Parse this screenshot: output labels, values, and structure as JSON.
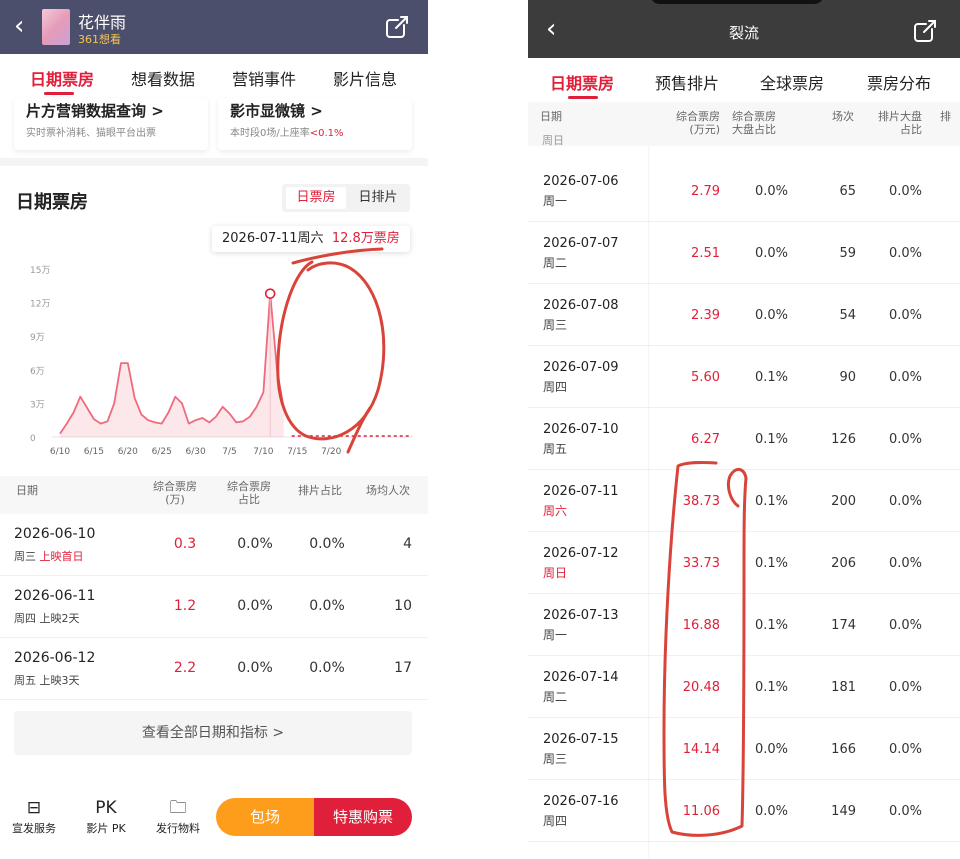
{
  "left": {
    "header": {
      "title": "花伴雨",
      "subtitle": "361想看"
    },
    "tabs": [
      "日期票房",
      "想看数据",
      "营销事件",
      "影片信息"
    ],
    "cards": [
      {
        "title": "片方营销数据查询 >",
        "sub": "实时票补消耗、猫眼平台出票"
      },
      {
        "title": "影市显微镜 >",
        "sub_prefix": "本时段0场/上座率",
        "sub_red": "<0.1%"
      }
    ],
    "section_title": "日期票房",
    "toggle": [
      "日票房",
      "日排片"
    ],
    "tooltip": {
      "date": "2026-07-11周六",
      "value": "12.8万票房"
    },
    "table_headers": [
      "日期",
      "综合票房\n(万)",
      "综合票房\n占比",
      "排片占比",
      "场均人次"
    ],
    "rows": [
      {
        "date": "2026-06-10",
        "weekday": "周三",
        "note": "上映首日",
        "note_red": true,
        "boxoffice": "0.3",
        "share": "0.0%",
        "schedule": "0.0%",
        "avg": "4"
      },
      {
        "date": "2026-06-11",
        "weekday": "周四",
        "note": "上映2天",
        "note_red": false,
        "boxoffice": "1.2",
        "share": "0.0%",
        "schedule": "0.0%",
        "avg": "10"
      },
      {
        "date": "2026-06-12",
        "weekday": "周五",
        "note": "上映3天",
        "note_red": false,
        "boxoffice": "2.2",
        "share": "0.0%",
        "schedule": "0.0%",
        "avg": "17"
      }
    ],
    "view_all": "查看全部日期和指标 >",
    "bottom_nav": [
      {
        "label": "宣发服务",
        "icon": "⊟"
      },
      {
        "label": "影片 PK",
        "icon": "PK"
      },
      {
        "label": "发行物料",
        "icon": "🗀"
      }
    ],
    "btn_baochang": "包场",
    "btn_buy": "特惠购票"
  },
  "right": {
    "header": {
      "title": "裂流"
    },
    "tabs": [
      "日期票房",
      "预售排片",
      "全球票房",
      "票房分布"
    ],
    "table_headers": [
      "日期",
      "综合票房\n(万元)",
      "综合票房\n大盘占比",
      "场次",
      "排片大盘\n占比",
      "排"
    ],
    "partial_row": "周日",
    "rows": [
      {
        "date": "2026-07-06",
        "weekday": "周一",
        "weekend": false,
        "boxoffice": "2.79",
        "share": "0.0%",
        "shows": "65",
        "schedule": "0.0%"
      },
      {
        "date": "2026-07-07",
        "weekday": "周二",
        "weekend": false,
        "boxoffice": "2.51",
        "share": "0.0%",
        "shows": "59",
        "schedule": "0.0%"
      },
      {
        "date": "2026-07-08",
        "weekday": "周三",
        "weekend": false,
        "boxoffice": "2.39",
        "share": "0.0%",
        "shows": "54",
        "schedule": "0.0%"
      },
      {
        "date": "2026-07-09",
        "weekday": "周四",
        "weekend": false,
        "boxoffice": "5.60",
        "share": "0.1%",
        "shows": "90",
        "schedule": "0.0%"
      },
      {
        "date": "2026-07-10",
        "weekday": "周五",
        "weekend": false,
        "boxoffice": "6.27",
        "share": "0.1%",
        "shows": "126",
        "schedule": "0.0%"
      },
      {
        "date": "2026-07-11",
        "weekday": "周六",
        "weekend": true,
        "boxoffice": "38.73",
        "share": "0.1%",
        "shows": "200",
        "schedule": "0.0%"
      },
      {
        "date": "2026-07-12",
        "weekday": "周日",
        "weekend": true,
        "boxoffice": "33.73",
        "share": "0.1%",
        "shows": "206",
        "schedule": "0.0%"
      },
      {
        "date": "2026-07-13",
        "weekday": "周一",
        "weekend": false,
        "boxoffice": "16.88",
        "share": "0.1%",
        "shows": "174",
        "schedule": "0.0%"
      },
      {
        "date": "2026-07-14",
        "weekday": "周二",
        "weekend": false,
        "boxoffice": "20.48",
        "share": "0.1%",
        "shows": "181",
        "schedule": "0.0%"
      },
      {
        "date": "2026-07-15",
        "weekday": "周三",
        "weekend": false,
        "boxoffice": "14.14",
        "share": "0.0%",
        "shows": "166",
        "schedule": "0.0%"
      },
      {
        "date": "2026-07-16",
        "weekday": "周四",
        "weekend": false,
        "boxoffice": "11.06",
        "share": "0.0%",
        "shows": "149",
        "schedule": "0.0%"
      }
    ]
  },
  "colors": {
    "accent": "#e0203a",
    "orange": "#fd9d1b",
    "left_header": "#4c4f6b",
    "right_header": "#3c3c3c",
    "annotation": "#d9443a"
  },
  "chart_data": {
    "type": "area",
    "x_ticks": [
      "6/10",
      "6/15",
      "6/20",
      "6/25",
      "6/30",
      "7/5",
      "7/10",
      "7/15",
      "7/20"
    ],
    "y_ticks": [
      "0",
      "3万",
      "6万",
      "9万",
      "12万",
      "15万"
    ],
    "ylim": [
      0,
      15
    ],
    "x_start_label": "6/10",
    "series": [
      {
        "unit": "万",
        "x": [
          "6/10",
          "6/11",
          "6/12",
          "6/13",
          "6/14",
          "6/15",
          "6/16",
          "6/17",
          "6/18",
          "6/19",
          "6/20",
          "6/21",
          "6/22",
          "6/23",
          "6/24",
          "6/25",
          "6/26",
          "6/27",
          "6/28",
          "6/29",
          "6/30",
          "7/1",
          "7/2",
          "7/3",
          "7/4",
          "7/5",
          "7/6",
          "7/7",
          "7/8",
          "7/9",
          "7/10",
          "7/11",
          "7/12",
          "7/13"
        ],
        "values": [
          0.3,
          1.2,
          2.2,
          3.6,
          2.6,
          1.6,
          1.2,
          1.4,
          3.0,
          6.6,
          6.6,
          3.5,
          2.0,
          1.5,
          1.3,
          1.2,
          2.2,
          3.6,
          3.0,
          1.2,
          1.5,
          1.7,
          1.3,
          1.8,
          2.7,
          2.1,
          1.3,
          1.4,
          1.8,
          2.7,
          4.0,
          12.8,
          6.0,
          2.6
        ],
        "dashed_after": "7/13"
      }
    ],
    "highlight": {
      "x": "7/11",
      "value": 12.8
    }
  }
}
